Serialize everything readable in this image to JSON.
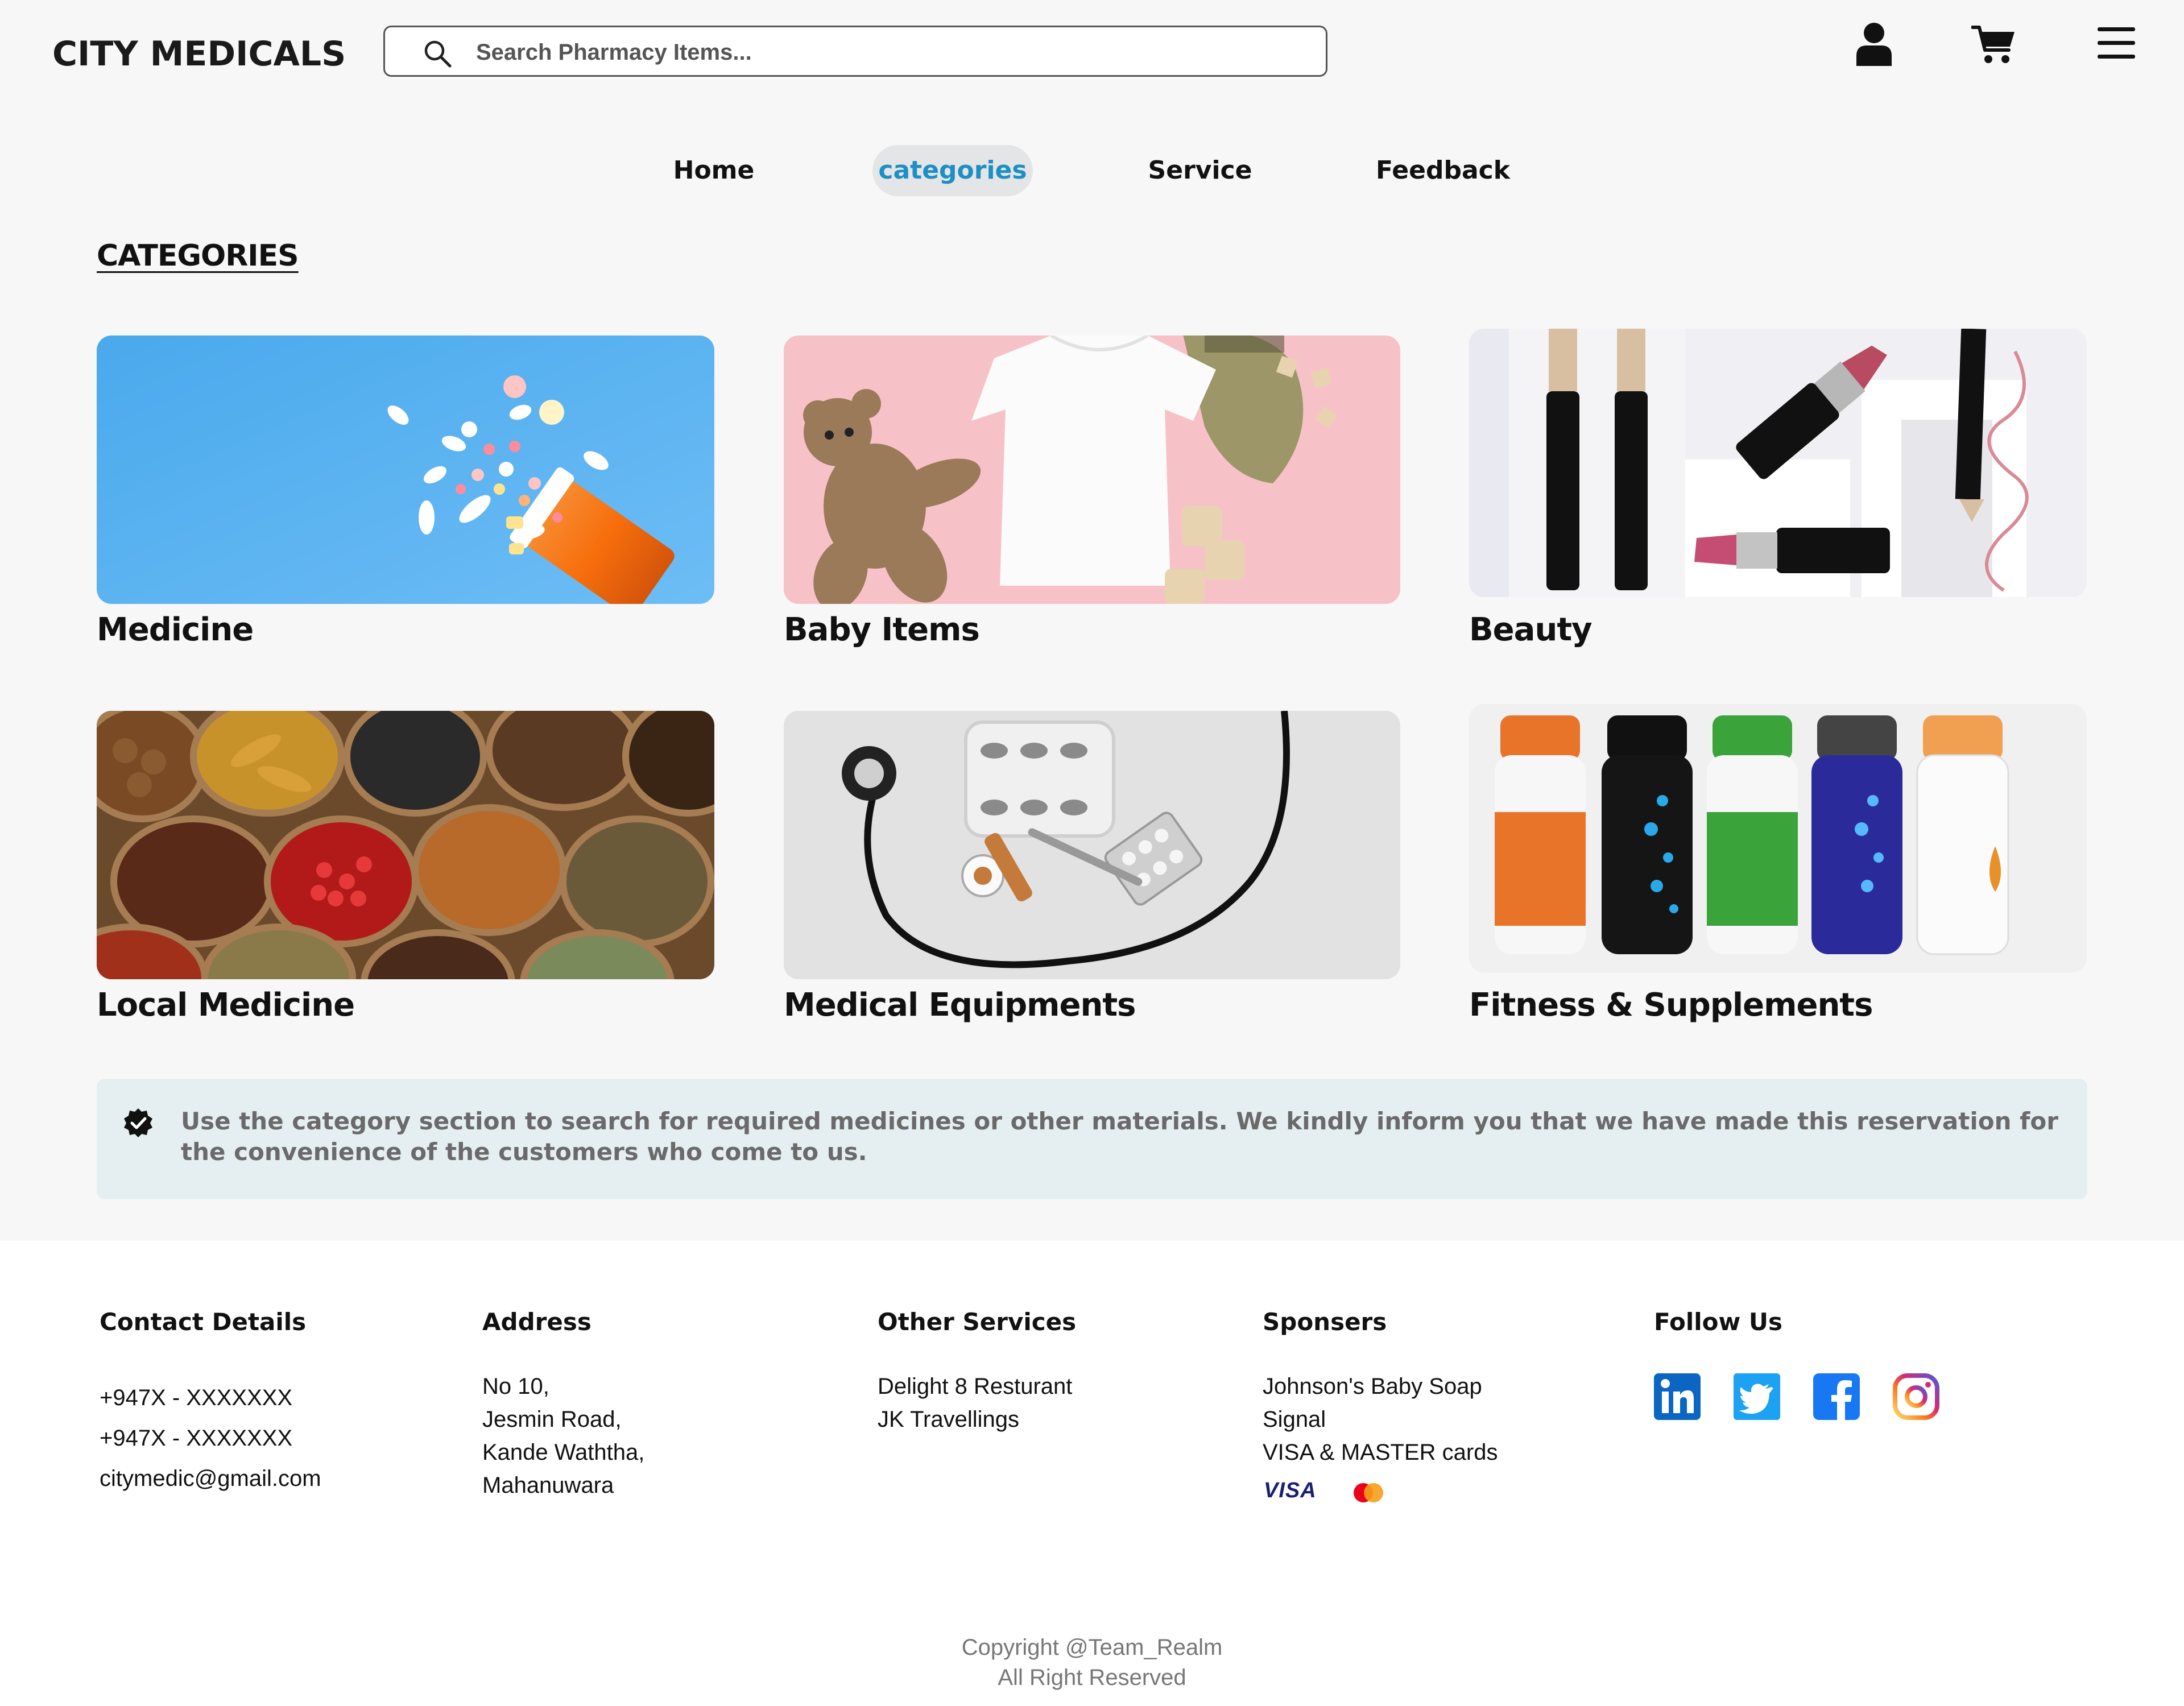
{
  "header": {
    "brand": "CITY MEDICALS",
    "search_placeholder": "Search Pharmacy Items...",
    "icons": [
      "search-icon",
      "user-icon",
      "cart-icon",
      "menu-icon"
    ]
  },
  "nav": {
    "items": [
      {
        "label": "Home",
        "active": false
      },
      {
        "label": "categories",
        "active": true
      },
      {
        "label": "Service",
        "active": false
      },
      {
        "label": "Feedback",
        "active": false
      }
    ],
    "active_color": "#1d8fc4"
  },
  "section_title": "CATEGORIES",
  "categories": [
    {
      "label": "Medicine"
    },
    {
      "label": "Baby Items"
    },
    {
      "label": "Beauty"
    },
    {
      "label": "Local Medicine"
    },
    {
      "label": "Medical Equipments"
    },
    {
      "label": "Fitness & Supplements"
    }
  ],
  "notice": {
    "icon": "verified-badge-icon",
    "text": "Use the category section to search for required medicines or other materials. We kindly inform you that we have made this reservation for the convenience of the customers who come to us."
  },
  "footer": {
    "contact": {
      "title": "Contact Details",
      "lines": [
        "+947X - XXXXXXX",
        "+947X - XXXXXXX",
        "citymedic@gmail.com"
      ]
    },
    "address": {
      "title": "Address",
      "lines": [
        "No 10,",
        "Jesmin Road,",
        "Kande Waththa,",
        "Mahanuwara"
      ]
    },
    "services": {
      "title": "Other Services",
      "lines": [
        "Delight 8 Resturant",
        "JK Travellings"
      ]
    },
    "sponsors": {
      "title": "Sponsers",
      "lines": [
        "Johnson's Baby Soap",
        "Signal",
        "VISA & MASTER cards"
      ],
      "visa_label": "VISA"
    },
    "follow": {
      "title": "Follow Us",
      "icons": [
        "linkedin-icon",
        "twitter-icon",
        "facebook-icon",
        "instagram-icon"
      ]
    },
    "copyright": "Copyright @Team_Realm",
    "rights": "All Right Reserved"
  }
}
